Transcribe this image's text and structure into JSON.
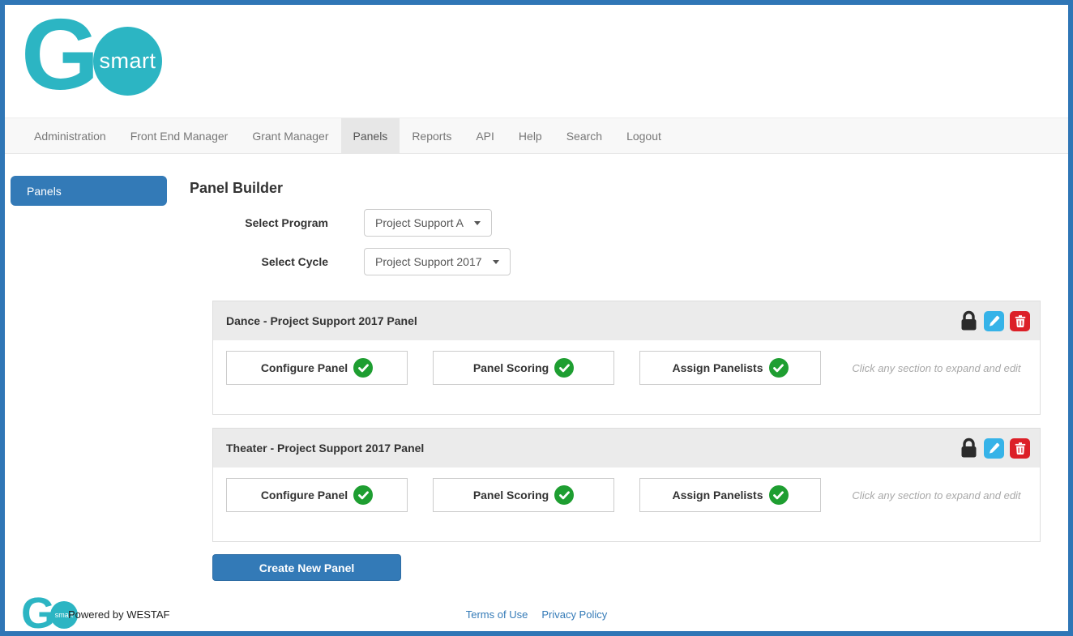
{
  "brand": {
    "g": "G",
    "smart": "smart",
    "powered_by": "Powered by WESTAF"
  },
  "nav": {
    "items": [
      {
        "label": "Administration",
        "active": false
      },
      {
        "label": "Front End Manager",
        "active": false
      },
      {
        "label": "Grant Manager",
        "active": false
      },
      {
        "label": "Panels",
        "active": true
      },
      {
        "label": "Reports",
        "active": false
      },
      {
        "label": "API",
        "active": false
      },
      {
        "label": "Help",
        "active": false
      },
      {
        "label": "Search",
        "active": false
      },
      {
        "label": "Logout",
        "active": false
      }
    ]
  },
  "sidebar": {
    "panels_label": "Panels"
  },
  "main": {
    "title": "Panel Builder",
    "program_label": "Select Program",
    "program_value": "Project Support A",
    "cycle_label": "Select Cycle",
    "cycle_value": "Project Support 2017",
    "panels": [
      {
        "title": "Dance - Project Support 2017 Panel",
        "sections": [
          {
            "label": "Configure Panel",
            "complete": true
          },
          {
            "label": "Panel Scoring",
            "complete": true
          },
          {
            "label": "Assign Panelists",
            "complete": true
          }
        ],
        "hint": "Click any section to expand and edit",
        "actions": [
          "lock-icon",
          "edit-icon",
          "delete-icon"
        ]
      },
      {
        "title": "Theater - Project Support 2017 Panel",
        "sections": [
          {
            "label": "Configure Panel",
            "complete": true
          },
          {
            "label": "Panel Scoring",
            "complete": true
          },
          {
            "label": "Assign Panelists",
            "complete": true
          }
        ],
        "hint": "Click any section to expand and edit",
        "actions": [
          "lock-icon",
          "edit-icon",
          "delete-icon"
        ]
      }
    ],
    "create_button": "Create New Panel"
  },
  "footer": {
    "links": [
      {
        "label": "Terms of Use"
      },
      {
        "label": "Privacy Policy"
      }
    ]
  },
  "colors": {
    "frame_blue": "#2f76b6",
    "brand_teal": "#2cb5c3",
    "primary_blue": "#337ab7",
    "nav_bg": "#f8f8f8",
    "nav_active_bg": "#e7e7e7",
    "card_header_bg": "#ebebeb",
    "complete_green": "#1e9e31",
    "edit_blue": "#36b3e8",
    "delete_red": "#dc2028"
  }
}
